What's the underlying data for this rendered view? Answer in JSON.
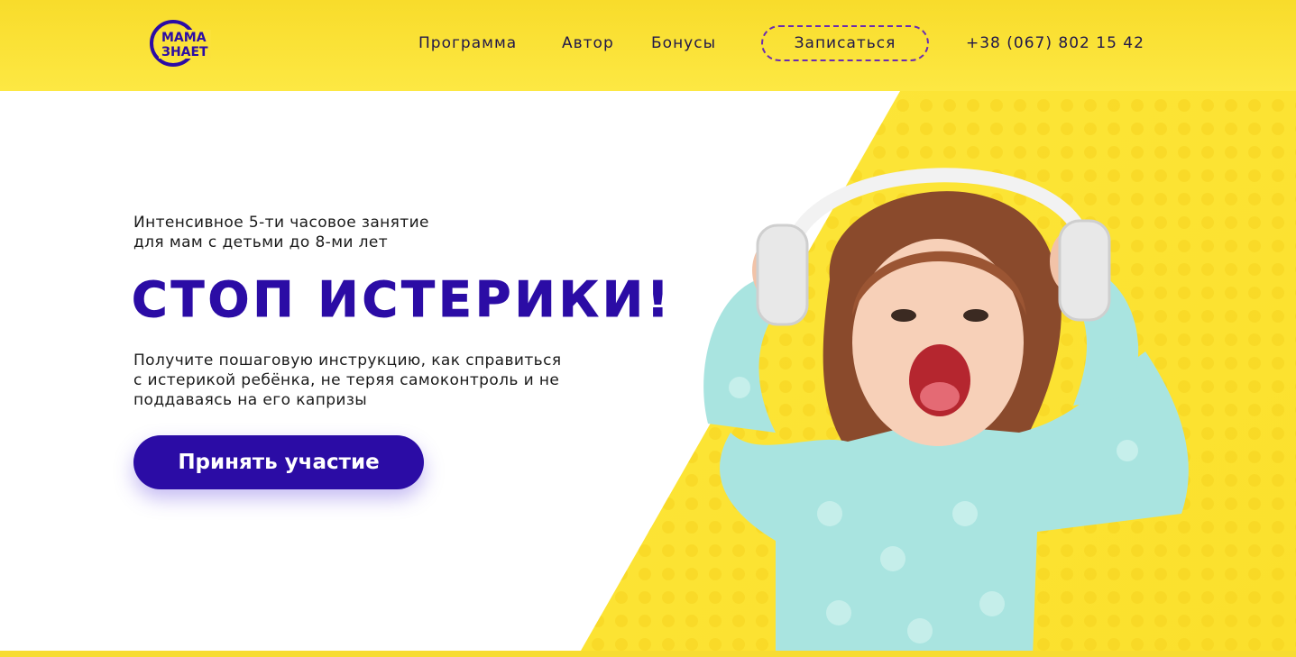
{
  "header": {
    "logo": {
      "line1": "МАМА",
      "line2": "ЗНАЕТ"
    },
    "nav": [
      {
        "label": "Программа"
      },
      {
        "label": "Автор"
      },
      {
        "label": "Бонусы"
      }
    ],
    "signup_label": "Записаться",
    "phone": "+38 (067) 802 15 42"
  },
  "hero": {
    "subtitle_line1": "Интенсивное 5-ти часовое занятие",
    "subtitle_line2": "для мам с детьми до 8-ми лет",
    "headline": "СТОП ИСТЕРИКИ!",
    "description_line1": "Получите пошаговую инструкцию, как справиться",
    "description_line2": "с истерикой ребёнка, не теряя самоконтроль и не",
    "description_line3": "поддаваясь на его капризы",
    "cta_label": "Принять участие"
  },
  "colors": {
    "header_yellow": "#f8dc2b",
    "hero_yellow": "#fbe32f",
    "brand_blue": "#2b0ca5",
    "text_dark": "#20174a",
    "sweater_teal": "#a9e4e0"
  },
  "icons": {
    "logo": "mama-znaet-logo-icon",
    "girl": "girl-with-headphones-illustration"
  }
}
